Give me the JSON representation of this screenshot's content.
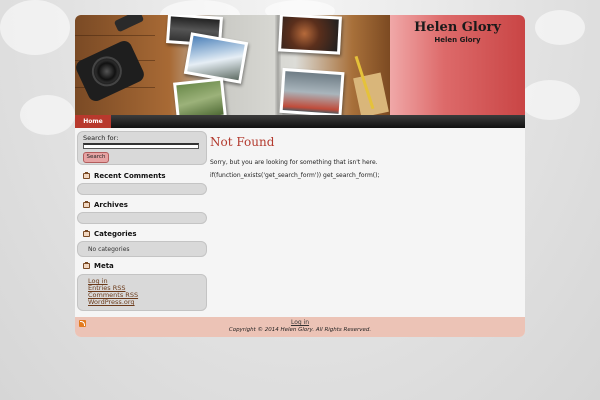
{
  "header": {
    "site_title": "Helen Glory",
    "site_description": "Helen Glory"
  },
  "nav": {
    "items": [
      {
        "label": "Home"
      }
    ]
  },
  "sidebar": {
    "search": {
      "label": "Search for:",
      "value": "",
      "button_label": "Search"
    },
    "widgets": {
      "recent_comments": {
        "title": "Recent Comments"
      },
      "archives": {
        "title": "Archives"
      },
      "categories": {
        "title": "Categories",
        "text": "No categories"
      },
      "meta": {
        "title": "Meta",
        "links": [
          "Log in",
          "Entries RSS",
          "Comments RSS",
          "WordPress.org"
        ]
      }
    }
  },
  "content": {
    "title": "Not Found",
    "message": "Sorry, but you are looking for something that isn't here.",
    "code_line": "if(function_exists('get_search_form')) get_search_form();"
  },
  "footer": {
    "login_link": "Log in",
    "copyright": "Copyright © 2014 Helen Glory. All Rights Reserved."
  },
  "colors": {
    "accent": "#b33a2e",
    "nav_active": "#b8392d",
    "footer_bg": "#ecc3b6",
    "title_box": "#dd6a6a"
  }
}
